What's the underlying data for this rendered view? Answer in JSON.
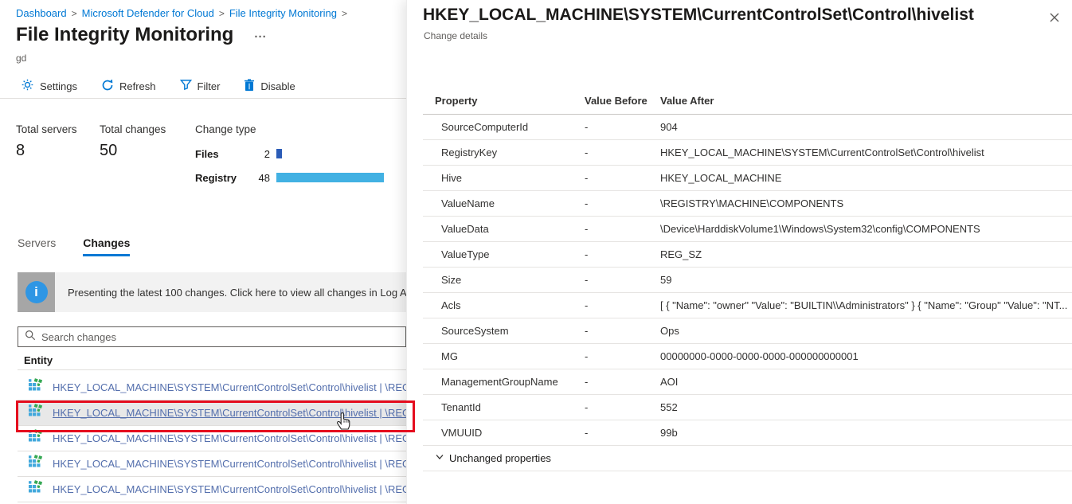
{
  "breadcrumb": {
    "items": [
      "Dashboard",
      "Microsoft Defender for Cloud",
      "File Integrity Monitoring"
    ],
    "separator": ">"
  },
  "page": {
    "title": "File Integrity Monitoring",
    "subtitle": "gd",
    "overflow_label": "..."
  },
  "toolbar": {
    "settings": "Settings",
    "refresh": "Refresh",
    "filter": "Filter",
    "disable": "Disable"
  },
  "stats": {
    "total_servers": {
      "label": "Total servers",
      "value": "8"
    },
    "total_changes": {
      "label": "Total changes",
      "value": "50"
    },
    "change_type": {
      "label": "Change type",
      "bars": [
        {
          "label": "Files",
          "value": 2,
          "color": "#2b5cb7"
        },
        {
          "label": "Registry",
          "value": 48,
          "color": "#42b1e3"
        }
      ]
    }
  },
  "tabs": [
    {
      "label": "Servers",
      "active": false
    },
    {
      "label": "Changes",
      "active": true
    }
  ],
  "banner": {
    "text": "Presenting the latest 100 changes. Click here to view all changes in Log Analytics"
  },
  "search": {
    "placeholder": "Search changes"
  },
  "table": {
    "header": "Entity",
    "selected_index": 1,
    "rows": [
      "HKEY_LOCAL_MACHINE\\SYSTEM\\CurrentControlSet\\Control\\hivelist | \\REGISTRY",
      "HKEY_LOCAL_MACHINE\\SYSTEM\\CurrentControlSet\\Control\\hivelist | \\REGISTRY",
      "HKEY_LOCAL_MACHINE\\SYSTEM\\CurrentControlSet\\Control\\hivelist | \\REGISTRY",
      "HKEY_LOCAL_MACHINE\\SYSTEM\\CurrentControlSet\\Control\\hivelist | \\REGISTRY",
      "HKEY_LOCAL_MACHINE\\SYSTEM\\CurrentControlSet\\Control\\hivelist | \\REGISTRY"
    ]
  },
  "panel": {
    "title": "HKEY_LOCAL_MACHINE\\SYSTEM\\CurrentControlSet\\Control\\hivelist",
    "subtitle": "Change details",
    "columns": [
      "Property",
      "Value Before",
      "Value After"
    ],
    "rows": [
      {
        "property": "SourceComputerId",
        "before": "-",
        "after": "904"
      },
      {
        "property": "RegistryKey",
        "before": "-",
        "after": "HKEY_LOCAL_MACHINE\\SYSTEM\\CurrentControlSet\\Control\\hivelist"
      },
      {
        "property": "Hive",
        "before": "-",
        "after": "HKEY_LOCAL_MACHINE"
      },
      {
        "property": "ValueName",
        "before": "-",
        "after": "\\REGISTRY\\MACHINE\\COMPONENTS"
      },
      {
        "property": "ValueData",
        "before": "-",
        "after": "\\Device\\HarddiskVolume1\\Windows\\System32\\config\\COMPONENTS"
      },
      {
        "property": "ValueType",
        "before": "-",
        "after": "REG_SZ"
      },
      {
        "property": "Size",
        "before": "-",
        "after": "59"
      },
      {
        "property": "Acls",
        "before": "-",
        "after": "[ { \"Name\": \"owner\" \"Value\": \"BUILTIN\\\\Administrators\" } { \"Name\": \"Group\" \"Value\": \"NT..."
      },
      {
        "property": "SourceSystem",
        "before": "-",
        "after": "Ops"
      },
      {
        "property": "MG",
        "before": "-",
        "after": "00000000-0000-0000-0000-000000000001"
      },
      {
        "property": "ManagementGroupName",
        "before": "-",
        "after": "AOI"
      },
      {
        "property": "TenantId",
        "before": "-",
        "after": "552"
      },
      {
        "property": "VMUUID",
        "before": "-",
        "after": "99b"
      }
    ],
    "unchanged_label": "Unchanged properties"
  },
  "colors": {
    "accent": "#0078d4",
    "entity_link": "#546fad",
    "files_bar": "#2b5cb7",
    "registry_bar": "#42b1e3",
    "annotation_red": "#e50d1e",
    "banner_bg": "#f2f2f2",
    "banner_icon_bg": "#a6a6a6",
    "info_icon_blue": "#2f96e4"
  }
}
